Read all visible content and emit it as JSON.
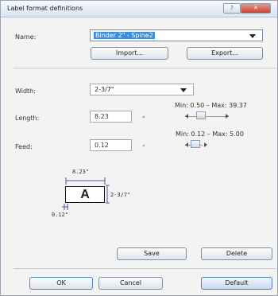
{
  "window": {
    "title": "Label format definitions",
    "help_button": "?",
    "close_button": "✕"
  },
  "name": {
    "label": "Name:",
    "value": "Binder 2\" - Spine2"
  },
  "actions": {
    "import": "Import...",
    "export": "Export..."
  },
  "width": {
    "label": "Width:",
    "value": "2-3/7\""
  },
  "length": {
    "label": "Length:",
    "value": "8.23",
    "unit": "\"",
    "range": "Min: 0.50 – Max: 39.37"
  },
  "feed": {
    "label": "Feed:",
    "value": "0.12",
    "unit": "\"",
    "range": "Min: 0.12 – Max: 5.00"
  },
  "diagram": {
    "length_value": "8.23\"",
    "letter": "A",
    "width_value": "2-3/7\"",
    "feed_value": "0.12\""
  },
  "buttons": {
    "save": "Save",
    "delete": "Delete",
    "ok": "OK",
    "cancel": "Cancel",
    "default": "Default"
  }
}
